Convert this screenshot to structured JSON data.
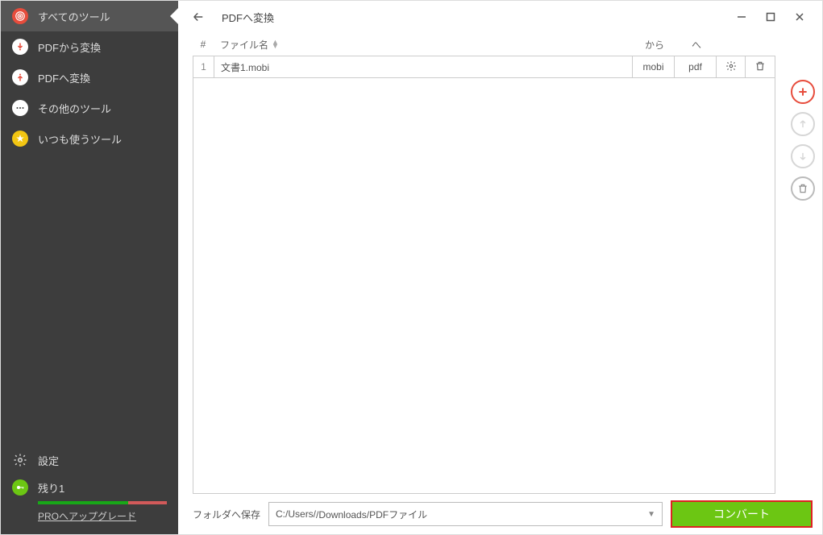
{
  "sidebar": {
    "items": [
      {
        "label": "すべてのツール",
        "icon": "spiral",
        "bg": "#e74c3c"
      },
      {
        "label": "PDFから変換",
        "icon": "down",
        "bg": "#e74c3c"
      },
      {
        "label": "PDFへ変換",
        "icon": "up",
        "bg": "#e74c3c"
      },
      {
        "label": "その他のツール",
        "icon": "dots",
        "bg": "#ffffff"
      },
      {
        "label": "いつも使うツール",
        "icon": "star",
        "bg": "#f3c613"
      }
    ],
    "settings_label": "設定",
    "remaining_label": "残り1",
    "upgrade_label": "PROへアップグレード"
  },
  "header": {
    "page_title": "PDFへ変換"
  },
  "table": {
    "col_num": "#",
    "col_name": "ファイル名",
    "col_from": "から",
    "col_to": "へ",
    "rows": [
      {
        "num": "1",
        "name": "文書1.mobi",
        "from": "mobi",
        "to": "pdf"
      }
    ]
  },
  "footer": {
    "save_label": "フォルダへ保存",
    "path_prefix": "C:/Users/",
    "path_mask": "       ",
    "path_suffix": "/Downloads/PDFファイル",
    "convert_label": "コンバート"
  }
}
